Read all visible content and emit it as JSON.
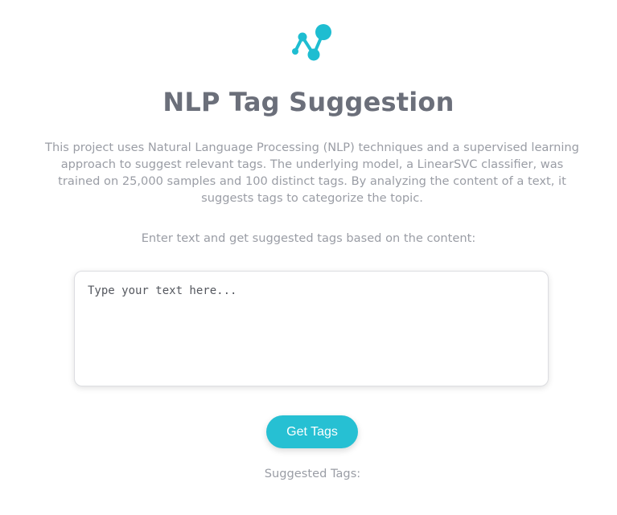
{
  "logo": {
    "icon": "network-nodes-icon",
    "color": "#1ebdd1"
  },
  "title": "NLP Tag Suggestion",
  "description": "This project uses Natural Language Processing (NLP) techniques and a supervised learning approach to suggest relevant tags. The underlying model, a LinearSVC classifier, was trained on 25,000 samples and 100 distinct tags. By analyzing the content of a text, it suggests tags to categorize the topic.",
  "instruction": "Enter text and get suggested tags based on the content:",
  "input": {
    "placeholder": "Type your text here...",
    "value": ""
  },
  "button": {
    "label": "Get Tags",
    "color": "#26c0d3"
  },
  "results": {
    "label": "Suggested Tags:",
    "tags": []
  }
}
